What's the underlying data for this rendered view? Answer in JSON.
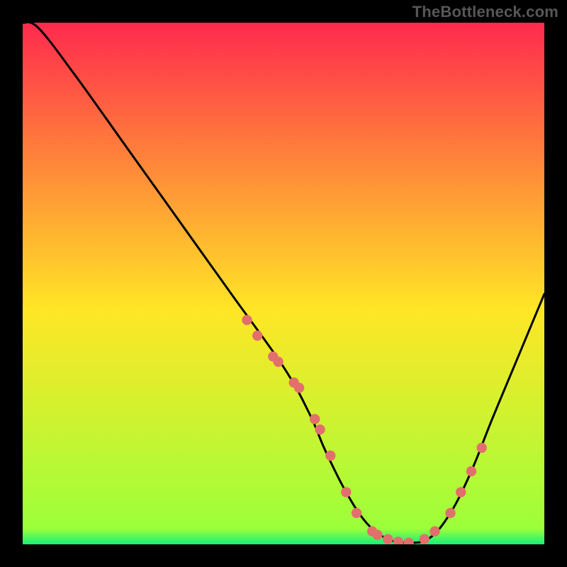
{
  "watermark": "TheBottleneck.com",
  "chart_data": {
    "type": "line",
    "title": "",
    "xlabel": "",
    "ylabel": "",
    "xlim": [
      0,
      100
    ],
    "ylim": [
      0,
      100
    ],
    "grid": false,
    "legend": "none",
    "gradient": {
      "top_color": "#ff2a4d",
      "mid_color": "#ffe626",
      "bottom_color": "#17f07a"
    },
    "curve_color": "#000000",
    "marker_color": "#e36f6c",
    "series": [
      {
        "name": "bottleneck-curve",
        "x": [
          0,
          3,
          10,
          20,
          30,
          40,
          50,
          55,
          58,
          62,
          66,
          70,
          74,
          78,
          82,
          86,
          90,
          95,
          100
        ],
        "y": [
          100,
          99,
          90,
          76,
          62,
          48,
          34,
          25,
          18,
          10,
          4,
          1,
          0.3,
          1.2,
          6,
          14,
          24,
          36,
          48
        ]
      }
    ],
    "markers": {
      "note": "estimated positions of salmon dots along the curve",
      "x": [
        43,
        45,
        48,
        49,
        52,
        53,
        56,
        57,
        59,
        62,
        64,
        67,
        68,
        70,
        72,
        74,
        77,
        79,
        82,
        84,
        86,
        88
      ],
      "y": [
        43,
        40,
        36,
        35,
        31,
        30,
        24,
        22,
        17,
        10,
        6,
        2.5,
        1.8,
        1.0,
        0.5,
        0.3,
        1.0,
        2.5,
        6,
        10,
        14,
        18.5
      ]
    }
  }
}
